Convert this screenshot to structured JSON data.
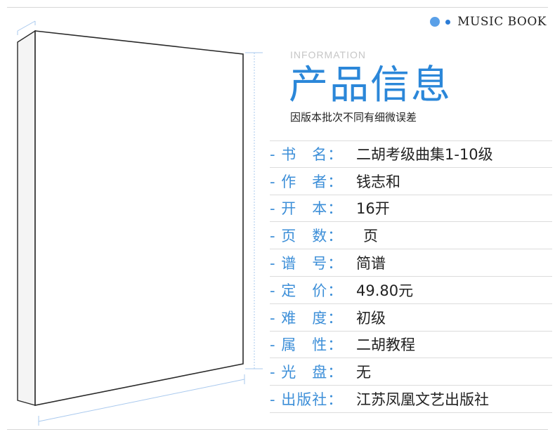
{
  "brand": {
    "text": "MUSIC BOOK"
  },
  "header": {
    "info_label": "INFORMATION",
    "title": "产品信息",
    "note": "因版本批次不同有细微误差"
  },
  "specs": [
    {
      "label": "- 书　名：",
      "value": "二胡考级曲集1-10级"
    },
    {
      "label": "- 作　者：",
      "value": "钱志和"
    },
    {
      "label": "- 开　本：",
      "value": "16开"
    },
    {
      "label": "- 页　数：",
      "value": "页"
    },
    {
      "label": "- 谱　号：",
      "value": "简谱"
    },
    {
      "label": "- 定　价：",
      "value": "49.80元"
    },
    {
      "label": "- 难　度：",
      "value": "初级"
    },
    {
      "label": "- 属　性：",
      "value": "二胡教程"
    },
    {
      "label": "- 光　盘：",
      "value": "无"
    },
    {
      "label": "- 出版社：",
      "value": "江苏凤凰文艺出版社"
    }
  ],
  "colors": {
    "accent": "#2b87d9",
    "label": "#3d8fd8",
    "rule": "#dcdcdc"
  },
  "icons": [
    "dot-icon",
    "book-cover-icon"
  ]
}
